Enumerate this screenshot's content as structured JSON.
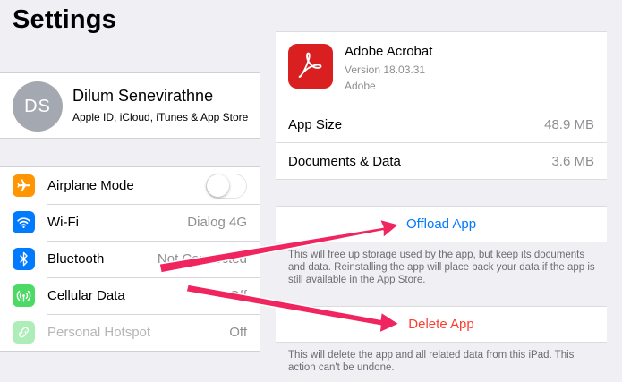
{
  "sidebar": {
    "title": "Settings",
    "profile": {
      "initials": "DS",
      "name": "Dilum Senevirathne",
      "subtitle": "Apple ID, iCloud, iTunes & App Store"
    },
    "items": [
      {
        "label": "Airplane Mode",
        "value": "",
        "icon": "airplane-icon",
        "color": "#ff9500"
      },
      {
        "label": "Wi-Fi",
        "value": "Dialog 4G",
        "icon": "wifi-icon",
        "color": "#007aff"
      },
      {
        "label": "Bluetooth",
        "value": "Not Connected",
        "icon": "bluetooth-icon",
        "color": "#007aff"
      },
      {
        "label": "Cellular Data",
        "value": "Off",
        "icon": "cellular-icon",
        "color": "#4cd964"
      },
      {
        "label": "Personal Hotspot",
        "value": "Off",
        "icon": "hotspot-icon",
        "color": "#4cd964"
      }
    ],
    "airplane_mode_on": false
  },
  "app": {
    "name": "Adobe Acrobat",
    "version": "Version 18.03.31",
    "vendor": "Adobe",
    "icon_color": "#d91f1f",
    "rows": [
      {
        "label": "App Size",
        "value": "48.9 MB"
      },
      {
        "label": "Documents & Data",
        "value": "3.6 MB"
      }
    ]
  },
  "actions": {
    "offload_label": "Offload App",
    "offload_note": "This will free up storage used by the app, but keep its documents and data. Reinstalling the app will place back your data if the app is still available in the App Store.",
    "delete_label": "Delete App",
    "delete_note": "This will delete the app and all related data from this iPad. This action can't be undone."
  },
  "colors": {
    "accent_blue": "#007aff",
    "destructive_red": "#ff3b30",
    "annotation_arrow": "#f0245e"
  }
}
